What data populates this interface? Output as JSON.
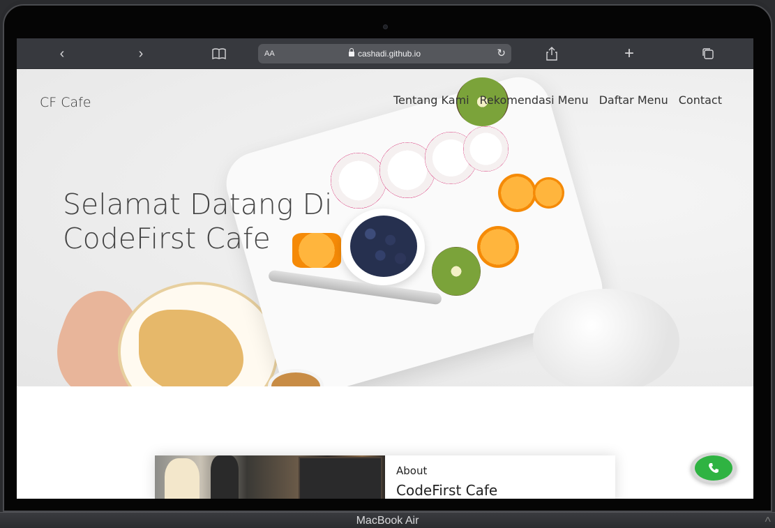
{
  "browser": {
    "nav_back": "‹",
    "nav_forward": "›",
    "bookmarks_icon": "book-icon",
    "address_aa": "AA",
    "url": "cashadi.github.io",
    "reload": "↻",
    "share": "⇪",
    "new_tab": "+",
    "tabs": "⧉"
  },
  "site": {
    "brand": "CF Cafe",
    "menu": [
      "Tentang Kami",
      "Rekomendasi Menu",
      "Daftar Menu",
      "Contact"
    ],
    "hero_title_line1": "Selamat Datang Di",
    "hero_title_line2": "CodeFirst Cafe",
    "about_label": "About",
    "about_title": "CodeFirst Cafe",
    "whatsapp_icon": "whatsapp-icon"
  },
  "device": {
    "label": "MacBook Air",
    "corner": "^"
  },
  "colors": {
    "toolbar": "#37393e",
    "whatsapp": "#2fb342",
    "text": "#333333"
  }
}
